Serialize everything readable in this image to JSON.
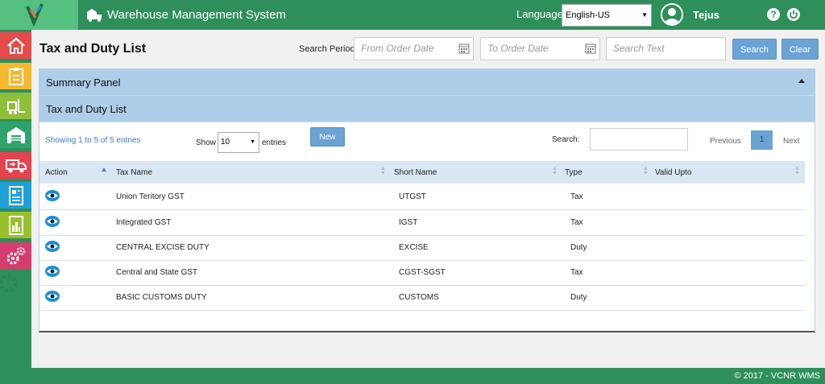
{
  "header": {
    "app_title": "Warehouse Management System",
    "language_label": "Language",
    "language_value": "English-US",
    "user_name": "Tejus",
    "help_glyph": "?"
  },
  "sidebar": {
    "items": [
      {
        "icon": "home-icon",
        "color": "#e54b4b"
      },
      {
        "icon": "clipboard-icon",
        "color": "#f5b82e"
      },
      {
        "icon": "forklift-icon",
        "color": "#8fbf3a"
      },
      {
        "icon": "warehouse-icon",
        "color": "#2fa36b"
      },
      {
        "icon": "delivery-truck-icon",
        "color": "#e5434f"
      },
      {
        "icon": "report-icon",
        "color": "#1f9fd8"
      },
      {
        "icon": "document-chart-icon",
        "color": "#9abf2e"
      },
      {
        "icon": "settings-gears-icon",
        "color": "#d63c6e"
      }
    ]
  },
  "page": {
    "title": "Tax and Duty List",
    "search_period_label": "Search Period",
    "from_placeholder": "From Order Date",
    "to_placeholder": "To Order Date",
    "search_text_placeholder": "Search Text",
    "search_button": "Search",
    "clear_button": "Clear"
  },
  "summary_panel": {
    "title": "Summary Panel"
  },
  "list_panel": {
    "title": "Tax and Duty List",
    "showing_text": "Showing 1 to 5 of 5 entries",
    "show_label": "Show",
    "page_size": "10",
    "entries_label": "entries",
    "new_button": "New",
    "search_label": "Search:",
    "previous": "Previous",
    "current_page": "1",
    "next": "Next"
  },
  "table": {
    "columns": [
      "Action",
      "Tax Name",
      "Short Name",
      "Type",
      "Valid Upto"
    ],
    "rows": [
      {
        "tax_name": "Union Teritory GST",
        "short_name": "UTGST",
        "type": "Tax",
        "valid_upto": ""
      },
      {
        "tax_name": "Integrated GST",
        "short_name": "IGST",
        "type": "Tax",
        "valid_upto": ""
      },
      {
        "tax_name": "CENTRAL EXCISE DUTY",
        "short_name": "EXCISE",
        "type": "Duty",
        "valid_upto": ""
      },
      {
        "tax_name": "Central and State GST",
        "short_name": "CGST-SGST",
        "type": "Tax",
        "valid_upto": ""
      },
      {
        "tax_name": "BASIC CUSTOMS DUTY",
        "short_name": "CUSTOMS",
        "type": "Duty",
        "valid_upto": ""
      }
    ]
  },
  "footer": {
    "text": "© 2017 - VCNR WMS"
  },
  "colors": {
    "brand": "#2f8f5b",
    "accent": "#6aa3d4",
    "panel_header": "#aecde8"
  }
}
